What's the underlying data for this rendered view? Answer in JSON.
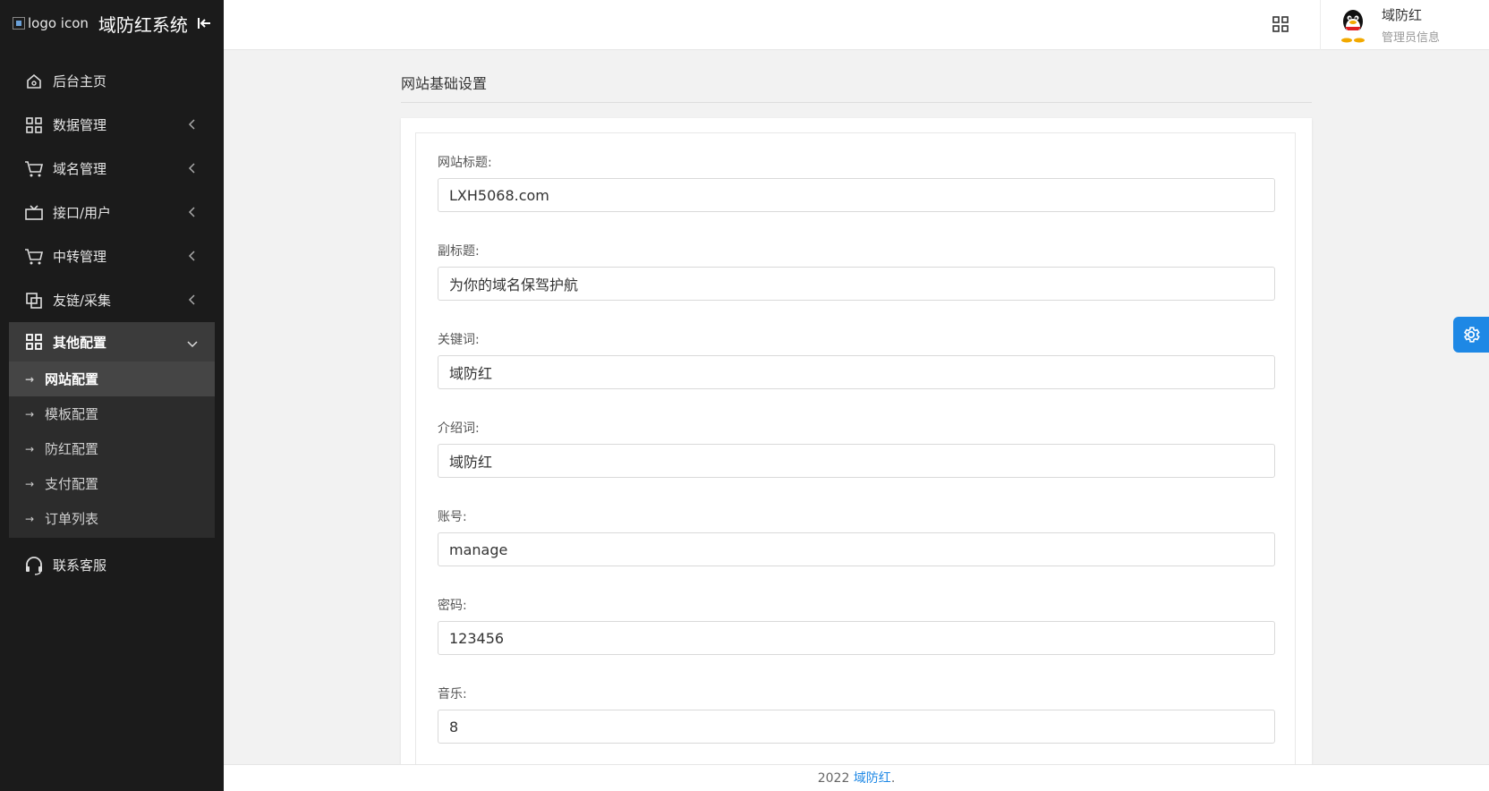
{
  "brand": {
    "logo_alt": "logo icon",
    "title": "域防红系统"
  },
  "sidebar": {
    "items": [
      {
        "label": "后台主页",
        "icon": "home-icon"
      },
      {
        "label": "数据管理",
        "icon": "grid-icon"
      },
      {
        "label": "域名管理",
        "icon": "cart-icon"
      },
      {
        "label": "接口/用户",
        "icon": "tv-icon"
      },
      {
        "label": "中转管理",
        "icon": "cart-icon"
      },
      {
        "label": "友链/采集",
        "icon": "copy-icon"
      },
      {
        "label": "其他配置",
        "icon": "grid-icon"
      }
    ],
    "submenu": [
      {
        "label": "网站配置",
        "active": true
      },
      {
        "label": "模板配置"
      },
      {
        "label": "防红配置"
      },
      {
        "label": "支付配置"
      },
      {
        "label": "订单列表"
      }
    ],
    "contact": {
      "label": "联系客服",
      "icon": "headset-icon"
    }
  },
  "header": {
    "user_name": "域防红",
    "user_sub": "管理员信息"
  },
  "main": {
    "section_title": "网站基础设置",
    "fields": [
      {
        "label": "网站标题:",
        "value": "LXH5068.com"
      },
      {
        "label": "副标题:",
        "value": "为你的域名保驾护航"
      },
      {
        "label": "关键词:",
        "value": "域防红"
      },
      {
        "label": "介绍词:",
        "value": "域防红"
      },
      {
        "label": "账号:",
        "value": "manage"
      },
      {
        "label": "密码:",
        "value": "123456"
      },
      {
        "label": "音乐:",
        "value": "8"
      }
    ]
  },
  "footer": {
    "year": "2022",
    "link": "域防红",
    "suffix": "."
  },
  "colors": {
    "sidebar_bg": "#1b1b1b",
    "accent": "#1e88e5"
  }
}
